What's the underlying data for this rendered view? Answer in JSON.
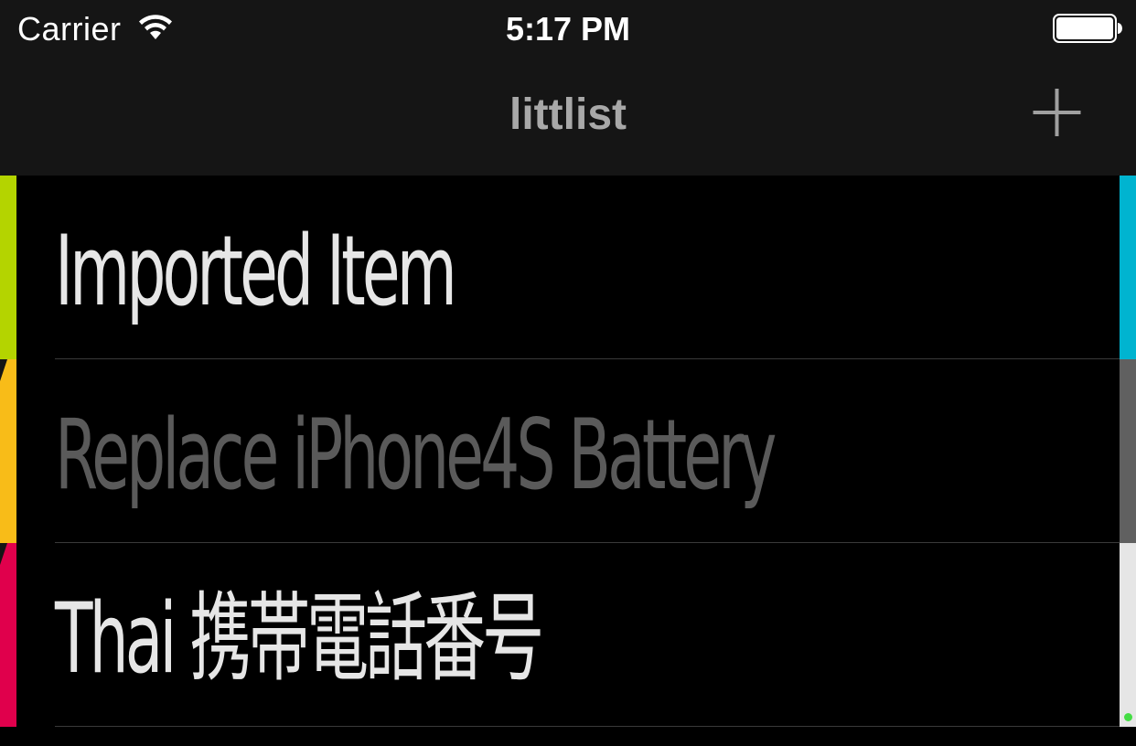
{
  "status_bar": {
    "carrier": "Carrier",
    "time": "5:17 PM",
    "wifi_icon": "wifi-icon",
    "battery_icon": "battery-icon"
  },
  "nav": {
    "title": "littlist",
    "add_icon": "plus-icon"
  },
  "colors": {
    "background": "#000000",
    "bar_background": "#151515",
    "title_color": "#a8a8a8",
    "item_text": "#e6e6e6",
    "item_text_dim": "#5a5a5a"
  },
  "list": {
    "items": [
      {
        "label": "Imported Item",
        "completed": false,
        "left_color": "#b4d400",
        "right_color": "#00b4d0"
      },
      {
        "label": "Replace iPhone4S Battery",
        "completed": true,
        "left_color": "#f8bc18",
        "right_color": "#606060"
      },
      {
        "label": "Thai 携帯電話番号",
        "completed": false,
        "left_color": "#e0004c",
        "right_color": "#e6e6e6"
      }
    ]
  }
}
